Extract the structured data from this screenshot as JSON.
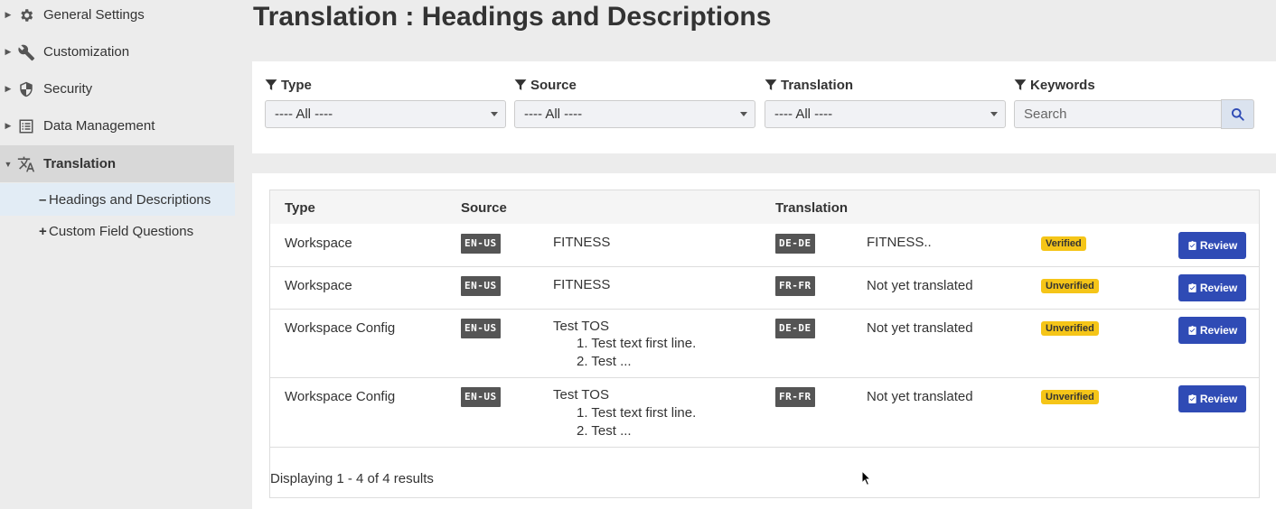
{
  "sidebar": {
    "items": [
      {
        "label": "General Settings",
        "icon": "gear-icon"
      },
      {
        "label": "Customization",
        "icon": "wrench-icon"
      },
      {
        "label": "Security",
        "icon": "shield-icon"
      },
      {
        "label": "Data Management",
        "icon": "list-icon"
      },
      {
        "label": "Translation",
        "icon": "translate-icon"
      }
    ],
    "sub_items": [
      {
        "mark": "–",
        "label": "Headings and Descriptions"
      },
      {
        "mark": "+",
        "label": "Custom Field Questions"
      }
    ]
  },
  "page": {
    "title": "Translation : Headings and Descriptions"
  },
  "filters": {
    "type": {
      "label": "Type",
      "value": "---- All ----"
    },
    "source": {
      "label": "Source",
      "value": "---- All ----"
    },
    "translation": {
      "label": "Translation",
      "value": "---- All ----"
    },
    "keywords": {
      "label": "Keywords",
      "placeholder": "Search"
    }
  },
  "table": {
    "headers": {
      "type": "Type",
      "source": "Source",
      "translation": "Translation"
    },
    "rows": [
      {
        "type": "Workspace",
        "source_lang": "EN-US",
        "source_text": "FITNESS",
        "source_list": [],
        "target_lang": "DE-DE",
        "translation": "FITNESS..",
        "status": "Verified",
        "action": "Review"
      },
      {
        "type": "Workspace",
        "source_lang": "EN-US",
        "source_text": "FITNESS",
        "source_list": [],
        "target_lang": "FR-FR",
        "translation": "Not yet translated",
        "status": "Unverified",
        "action": "Review"
      },
      {
        "type": "Workspace Config",
        "source_lang": "EN-US",
        "source_text": "Test TOS",
        "source_list": [
          "1. Test text first line.",
          "2. Test ..."
        ],
        "target_lang": "DE-DE",
        "translation": "Not yet translated",
        "status": "Unverified",
        "action": "Review"
      },
      {
        "type": "Workspace Config",
        "source_lang": "EN-US",
        "source_text": "Test TOS",
        "source_list": [
          "1. Test text first line.",
          "2. Test ..."
        ],
        "target_lang": "FR-FR",
        "translation": "Not yet translated",
        "status": "Unverified",
        "action": "Review"
      }
    ],
    "footer": "Displaying 1 - 4 of 4 results"
  },
  "colors": {
    "primary_button": "#2f4bb5",
    "badge_status": "#f5c518",
    "badge_lang": "#555555",
    "active_sub_item": "#e2ecf5"
  }
}
